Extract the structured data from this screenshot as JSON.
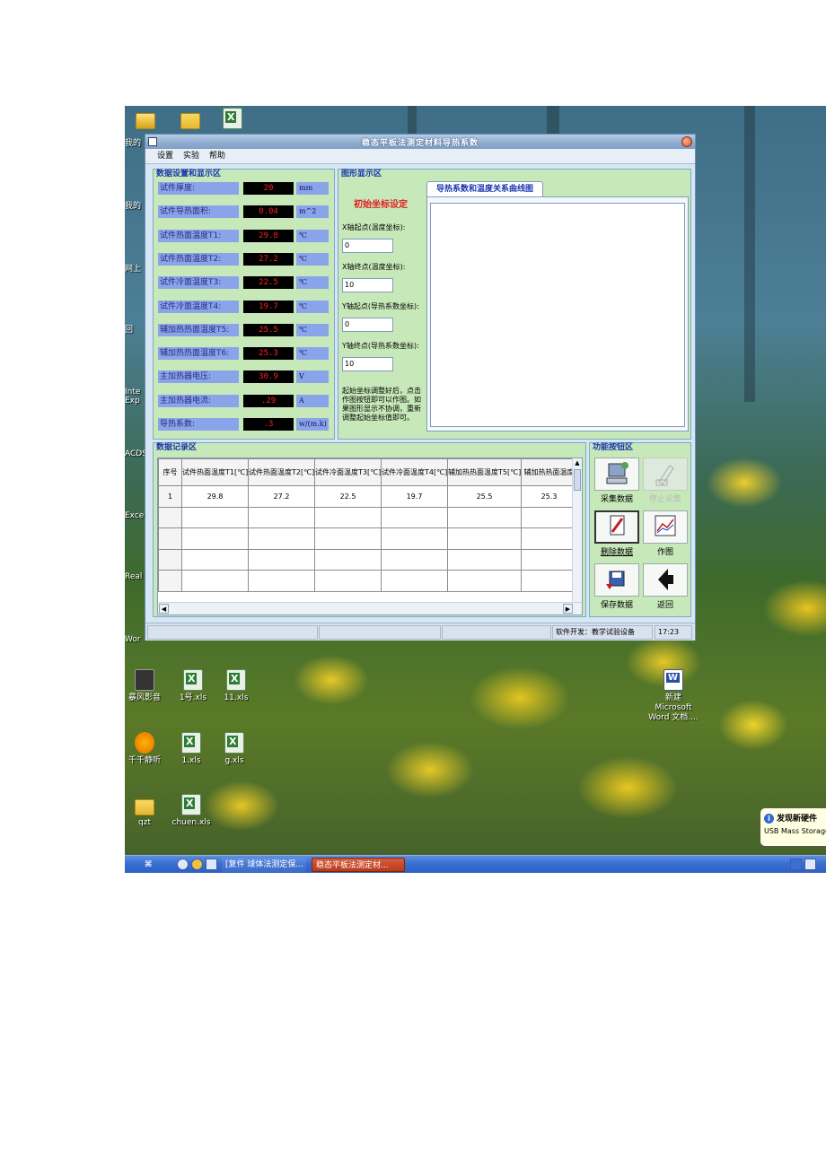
{
  "desktop": {
    "icons": [
      {
        "label": "暴风影音",
        "kind": "media"
      },
      {
        "label": "1号.xls",
        "kind": "xls"
      },
      {
        "label": "11.xls",
        "kind": "xls"
      },
      {
        "label": "新建 Microsoft Word 文档....",
        "kind": "doc"
      },
      {
        "label": "千千静听",
        "kind": "app"
      },
      {
        "label": "1.xls",
        "kind": "xls"
      },
      {
        "label": "g.xls",
        "kind": "xls"
      },
      {
        "label": "qzt",
        "kind": "folder"
      },
      {
        "label": "chuen.xls",
        "kind": "xls"
      }
    ],
    "edge_labels": [
      "我的",
      "我的",
      "网上",
      "回",
      "Inte Exp",
      "ACDS",
      "Exce",
      "Real",
      "Wor"
    ]
  },
  "window": {
    "title": "稳态平板法测定材料导热系数",
    "menu": [
      "设置",
      "实验",
      "帮助"
    ],
    "data_panel": {
      "title": "数据设置和显示区",
      "rows": [
        {
          "label": "试件厚度:",
          "value": "20",
          "unit": "mm"
        },
        {
          "label": "试件导热面积:",
          "value": "0.04",
          "unit": "m^2"
        },
        {
          "label": "试件热面温度T1:",
          "value": "29.8",
          "unit": "℃"
        },
        {
          "label": "试件热面温度T2:",
          "value": "27.2",
          "unit": "℃"
        },
        {
          "label": "试件冷面温度T3:",
          "value": "22.5",
          "unit": "℃"
        },
        {
          "label": "试件冷面温度T4:",
          "value": "19.7",
          "unit": "℃"
        },
        {
          "label": "辅加热热面温度T5:",
          "value": "25.5",
          "unit": "℃"
        },
        {
          "label": "辅加热热面温度T6:",
          "value": "25.3",
          "unit": "℃"
        },
        {
          "label": "主加热器电压:",
          "value": "30.9",
          "unit": "V"
        },
        {
          "label": "主加热器电流:",
          "value": ".29",
          "unit": "A"
        },
        {
          "label": "导热系数:",
          "value": ".3",
          "unit": "w/(m.k)"
        }
      ]
    },
    "graph_panel": {
      "title": "图形显示区",
      "init_title": "初始坐标设定",
      "fields": [
        {
          "label": "X轴起点(温度坐标):",
          "value": "0"
        },
        {
          "label": "X轴终点(温度坐标):",
          "value": "10"
        },
        {
          "label": "Y轴起点(导热系数坐标):",
          "value": "0"
        },
        {
          "label": "Y轴终点(导热系数坐标):",
          "value": "10"
        }
      ],
      "hint": "起始坐标调整好后，点击作图按钮即可以作图。如果图形显示不协调，重新调整起始坐标值即可。",
      "tab": "导热系数和温度关系曲线图"
    },
    "record_panel": {
      "title": "数据记录区",
      "headers": [
        "序号",
        "试件热面温度T1[℃]",
        "试件热面温度T2[℃]",
        "试件冷面温度T3[℃]",
        "试件冷面温度T4[℃]",
        "辅加热热面温度T5[℃]",
        "辅加热热面温度"
      ],
      "rows": [
        [
          "1",
          "29.8",
          "27.2",
          "22.5",
          "19.7",
          "25.5",
          "25.3"
        ],
        [
          "",
          "",
          "",
          "",
          "",
          "",
          ""
        ],
        [
          "",
          "",
          "",
          "",
          "",
          "",
          ""
        ],
        [
          "",
          "",
          "",
          "",
          "",
          "",
          ""
        ],
        [
          "",
          "",
          "",
          "",
          "",
          "",
          ""
        ]
      ]
    },
    "function_panel": {
      "title": "功能按钮区",
      "buttons": [
        {
          "label": "采集数据",
          "enabled": true
        },
        {
          "label": "停止采集",
          "enabled": false
        },
        {
          "label": "删除数据",
          "enabled": true
        },
        {
          "label": "作图",
          "enabled": true
        },
        {
          "label": "保存数据",
          "enabled": true
        },
        {
          "label": "返回",
          "enabled": true
        }
      ]
    },
    "status": {
      "developer": "软件开发：教学试验设备",
      "time": "17:23"
    }
  },
  "taskbar": {
    "tasks": [
      "[复件 球体法测定保...",
      "稳态平板法测定材..."
    ]
  },
  "balloon": {
    "title": "发现新硬件",
    "text": "USB Mass Storage De"
  }
}
